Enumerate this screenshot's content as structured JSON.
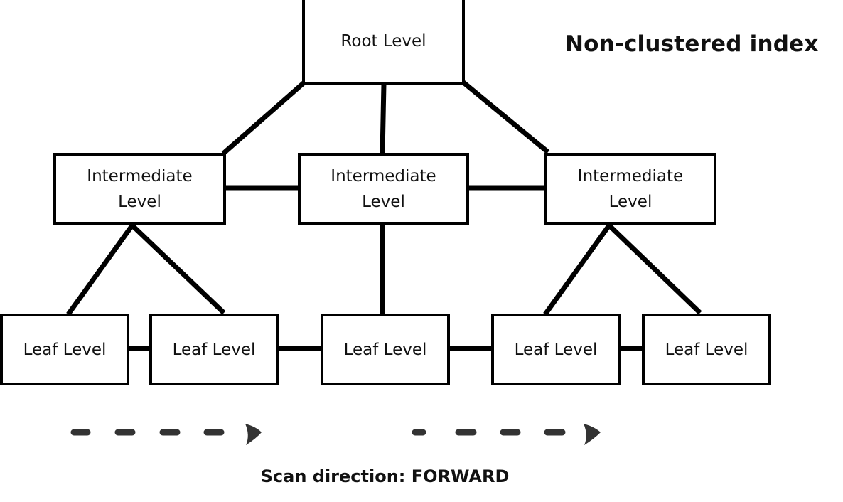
{
  "diagram": {
    "title": "Non-clustered index",
    "caption": "Scan direction: FORWARD",
    "colors": {
      "line": "#000000",
      "arrow": "#333333",
      "background": "#ffffff"
    },
    "nodes": {
      "root": {
        "label": "Root Level"
      },
      "intermediate": [
        {
          "line1": "Intermediate",
          "line2": "Level"
        },
        {
          "line1": "Intermediate",
          "line2": "Level"
        },
        {
          "line1": "Intermediate",
          "line2": "Level"
        }
      ],
      "leaves": [
        {
          "label": "Leaf Level"
        },
        {
          "label": "Leaf Level"
        },
        {
          "label": "Leaf Level"
        },
        {
          "label": "Leaf Level"
        },
        {
          "label": "Leaf Level"
        }
      ]
    },
    "edges": [
      {
        "from": "root",
        "to": "intermediate-1"
      },
      {
        "from": "root",
        "to": "intermediate-2"
      },
      {
        "from": "root",
        "to": "intermediate-3"
      },
      {
        "from": "intermediate-1",
        "to": "intermediate-2"
      },
      {
        "from": "intermediate-2",
        "to": "intermediate-3"
      },
      {
        "from": "intermediate-1",
        "to": "leaf-1"
      },
      {
        "from": "intermediate-1",
        "to": "leaf-2"
      },
      {
        "from": "intermediate-2",
        "to": "leaf-3"
      },
      {
        "from": "intermediate-3",
        "to": "leaf-4"
      },
      {
        "from": "intermediate-3",
        "to": "leaf-5"
      },
      {
        "from": "leaf-1",
        "to": "leaf-2"
      },
      {
        "from": "leaf-2",
        "to": "leaf-3"
      },
      {
        "from": "leaf-3",
        "to": "leaf-4"
      },
      {
        "from": "leaf-4",
        "to": "leaf-5"
      }
    ],
    "scan_arrows": [
      {
        "direction": "forward"
      },
      {
        "direction": "forward"
      }
    ]
  }
}
